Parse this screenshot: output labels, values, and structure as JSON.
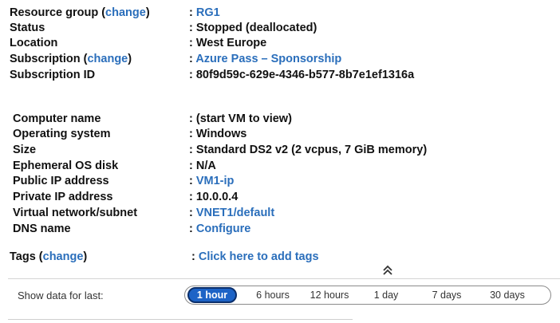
{
  "group1": {
    "resource_group": {
      "label": "Resource group",
      "change_open": " (",
      "change": "change",
      "change_close": ")",
      "value": "RG1"
    },
    "status": {
      "label": "Status",
      "value": "Stopped (deallocated)"
    },
    "location": {
      "label": "Location",
      "value": "West Europe"
    },
    "subscription": {
      "label": "Subscription",
      "change_open": " (",
      "change": "change",
      "change_close": ")",
      "value": "Azure Pass – Sponsorship"
    },
    "subscription_id": {
      "label": "Subscription ID",
      "value": "80f9d59c-629e-4346-b577-8b7e1ef1316a"
    }
  },
  "group2": {
    "computer_name": {
      "label": "Computer name",
      "value": "(start VM to view)"
    },
    "os": {
      "label": "Operating system",
      "value": "Windows"
    },
    "size": {
      "label": "Size",
      "value": "Standard DS2 v2 (2 vcpus, 7 GiB memory)"
    },
    "ephemeral": {
      "label": "Ephemeral OS disk",
      "value": "N/A"
    },
    "public_ip": {
      "label": "Public IP address",
      "value": "VM1-ip"
    },
    "private_ip": {
      "label": "Private IP address",
      "value": "10.0.0.4"
    },
    "vnet": {
      "label": "Virtual network/subnet",
      "value": "VNET1/default"
    },
    "dns": {
      "label": "DNS name",
      "value": "Configure"
    }
  },
  "tags": {
    "label": "Tags",
    "change_open": " (",
    "change": "change",
    "change_close": ")",
    "value": "Click here to add tags"
  },
  "colon": ": ",
  "collapse_icon": "double-chevron-up-icon",
  "time_range": {
    "label": "Show data for last:",
    "options": [
      "1 hour",
      "6 hours",
      "12 hours",
      "1 day",
      "7 days",
      "30 days"
    ],
    "selected": "1 hour"
  },
  "colors": {
    "link": "#2a6ebb",
    "active": "#1d63c6"
  }
}
